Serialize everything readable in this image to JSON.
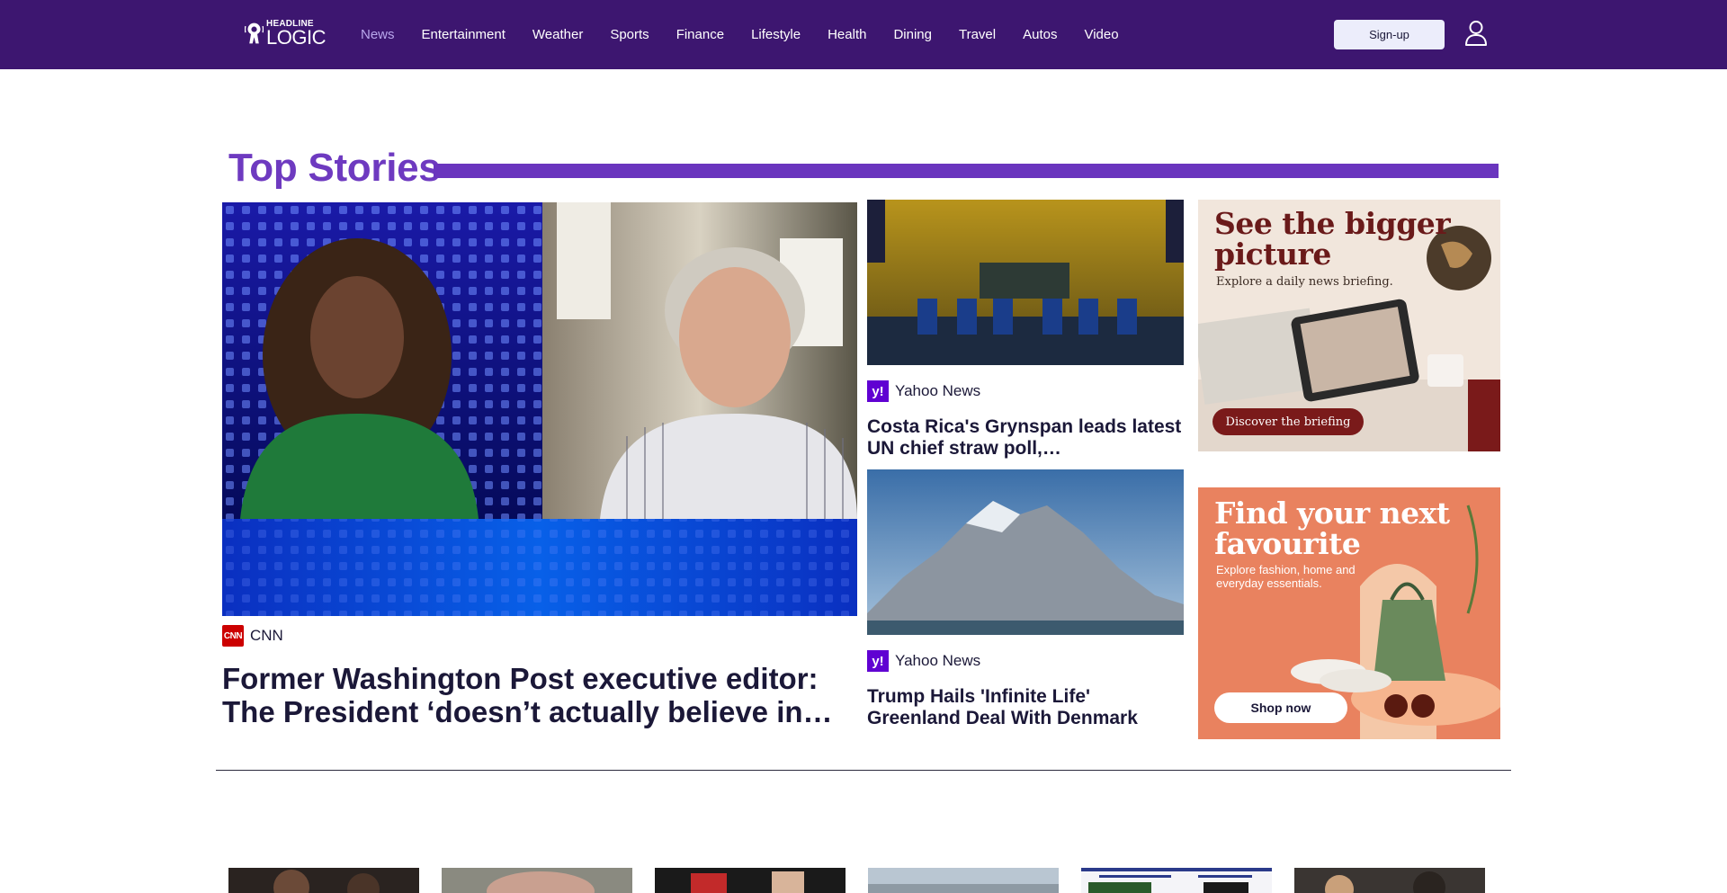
{
  "brand": {
    "logo_top": "HEADLINE",
    "logo_bottom": "LOGIC"
  },
  "nav": {
    "items": [
      {
        "label": "News",
        "active": true
      },
      {
        "label": "Entertainment"
      },
      {
        "label": "Weather"
      },
      {
        "label": "Sports"
      },
      {
        "label": "Finance"
      },
      {
        "label": "Lifestyle"
      },
      {
        "label": "Health"
      },
      {
        "label": "Dining"
      },
      {
        "label": "Travel"
      },
      {
        "label": "Autos"
      },
      {
        "label": "Video"
      }
    ],
    "signup_label": "Sign-up"
  },
  "top_stories": {
    "title": "Top Stories",
    "main": {
      "source": "CNN",
      "source_logo": "CNN",
      "headline": "Former Washington Post executive editor: The President ‘doesn’t actually believe in…"
    },
    "side": [
      {
        "source": "Yahoo News",
        "source_logo": "y!",
        "headline": "Costa Rica's Grynspan leads latest UN chief straw poll,…"
      },
      {
        "source": "Yahoo News",
        "source_logo": "y!",
        "headline": "Trump Hails 'Infinite Life' Greenland Deal With Denmark"
      }
    ]
  },
  "ads": [
    {
      "title_line1": "See the bigger",
      "title_line2": "picture",
      "subtitle": "Explore a daily news briefing.",
      "cta": "Discover the briefing"
    },
    {
      "title_line1": "Find your next",
      "title_line2": "favourite",
      "subtitle_line1": "Explore fashion, home and",
      "subtitle_line2": "everyday essentials.",
      "cta": "Shop now"
    }
  ],
  "colors": {
    "header_bg": "#3d1670",
    "accent": "#6e3ac0",
    "nav_active": "#b9a7ec"
  },
  "icons": [
    "headline-logic-logo",
    "user-icon",
    "cnn-logo",
    "yahoo-logo"
  ]
}
